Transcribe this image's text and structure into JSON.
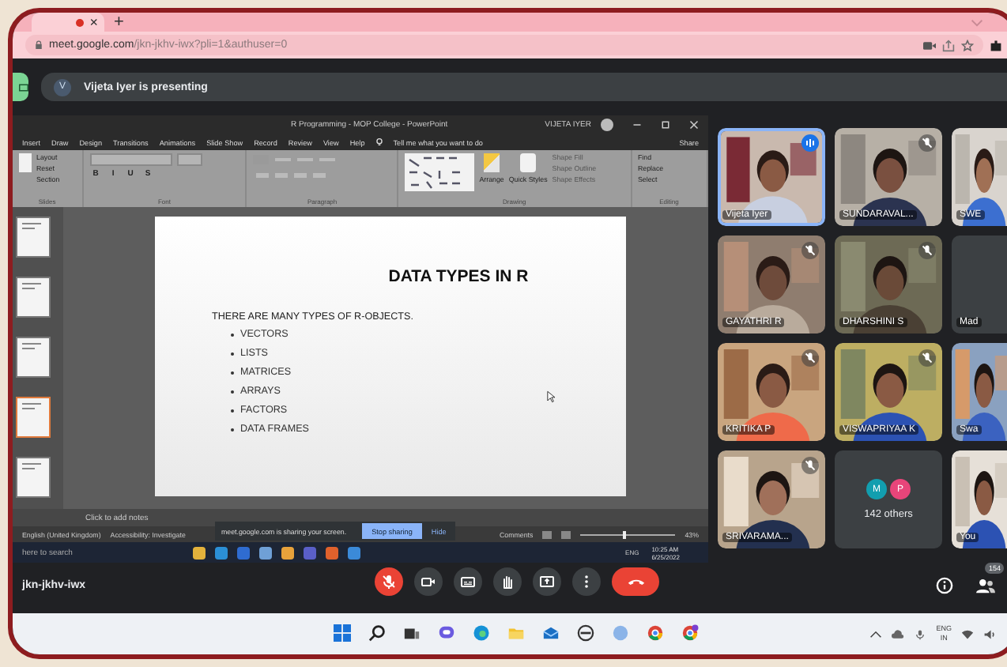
{
  "browser": {
    "tabs": [
      {
        "kind": "recording",
        "close": "×",
        "selected": true
      }
    ],
    "new_tab": "+",
    "url_host": "meet.google.com",
    "url_path": "/jkn-jkhv-iwx?pli=1&authuser=0"
  },
  "meet": {
    "presenter_initial": "V",
    "presenting_text": "Vijeta Iyer is presenting",
    "meeting_code": "jkn-jkhv-iwx",
    "participant_count": "154",
    "controls": [
      {
        "kind": "mic",
        "on": false
      },
      {
        "kind": "camera",
        "on": true
      },
      {
        "kind": "captions"
      },
      {
        "kind": "hand"
      },
      {
        "kind": "present"
      },
      {
        "kind": "more"
      },
      {
        "kind": "leave"
      }
    ],
    "tiles": [
      {
        "kind": "video",
        "name": "Vijeta Iyer",
        "speaking": true,
        "muted": false
      },
      {
        "kind": "video",
        "name": "SUNDARAVAL...",
        "speaking": false,
        "muted": true
      },
      {
        "kind": "video",
        "name": "SWE",
        "speaking": false,
        "muted": false
      },
      {
        "kind": "video",
        "name": "GAYATHRI R",
        "speaking": false,
        "muted": true
      },
      {
        "kind": "video",
        "name": "DHARSHINI S",
        "speaking": false,
        "muted": true
      },
      {
        "kind": "blank",
        "name": "Mad"
      },
      {
        "kind": "video",
        "name": "KRITIKA P",
        "speaking": false,
        "muted": true
      },
      {
        "kind": "video",
        "name": "VISWAPRIYAA K",
        "speaking": false,
        "muted": true
      },
      {
        "kind": "video",
        "name": "Swa",
        "speaking": false,
        "muted": false
      },
      {
        "kind": "video",
        "name": "SRIVARAMA...",
        "speaking": false,
        "muted": true
      },
      {
        "kind": "others",
        "name": "142 others",
        "avatars": [
          {
            "initial": "M",
            "color": "#129eaf"
          },
          {
            "initial": "P",
            "color": "#e8457a"
          }
        ]
      },
      {
        "kind": "video",
        "name": "You",
        "speaking": false,
        "muted": false
      }
    ]
  },
  "presentation": {
    "app_title": "R Programming - MOP College - PowerPoint",
    "user": "VIJETA IYER",
    "ribbon_tabs": [
      "Insert",
      "Draw",
      "Design",
      "Transitions",
      "Animations",
      "Slide Show",
      "Record",
      "Review",
      "View",
      "Help"
    ],
    "tell_me": "Tell me what you want to do",
    "share": "Share",
    "slides_items": [
      "Layout",
      "Reset",
      "Section"
    ],
    "format_buttons": [
      "B",
      "I",
      "U",
      "S"
    ],
    "drawing_items": [
      "Shape Fill",
      "Shape Outline",
      "Shape Effects"
    ],
    "arrange": "Arrange",
    "quick_styles": "Quick Styles",
    "editing_items": [
      "Find",
      "Replace",
      "Select"
    ],
    "group_labels": [
      "Slides",
      "Font",
      "Paragraph",
      "Drawing",
      "Editing"
    ],
    "thumbnails": [
      {
        "selected": false
      },
      {
        "selected": false
      },
      {
        "selected": false
      },
      {
        "selected": true
      },
      {
        "selected": false
      }
    ],
    "slide": {
      "title": "DATA TYPES IN R",
      "intro": "THERE ARE MANY TYPES OF R-OBJECTS.",
      "bullets": [
        "VECTORS",
        "LISTS",
        "MATRICES",
        "ARRAYS",
        "FACTORS",
        "DATA FRAMES"
      ]
    },
    "notes_placeholder": "Click to add notes",
    "status_items": [
      "English (United Kingdom)",
      "Accessibility: Investigate"
    ],
    "comments": "Comments",
    "zoom": {
      "level": 0.45,
      "reading": "43%"
    },
    "sharing_banner": {
      "text": "meet.google.com is sharing your screen.",
      "stop": "Stop sharing",
      "hide": "Hide"
    },
    "win_taskbar": {
      "search": "here to search",
      "lang": "ENG",
      "time": "10:25 AM",
      "date": "6/25/2022"
    }
  },
  "taskbar": {
    "lang": "ENG",
    "region": "IN"
  }
}
